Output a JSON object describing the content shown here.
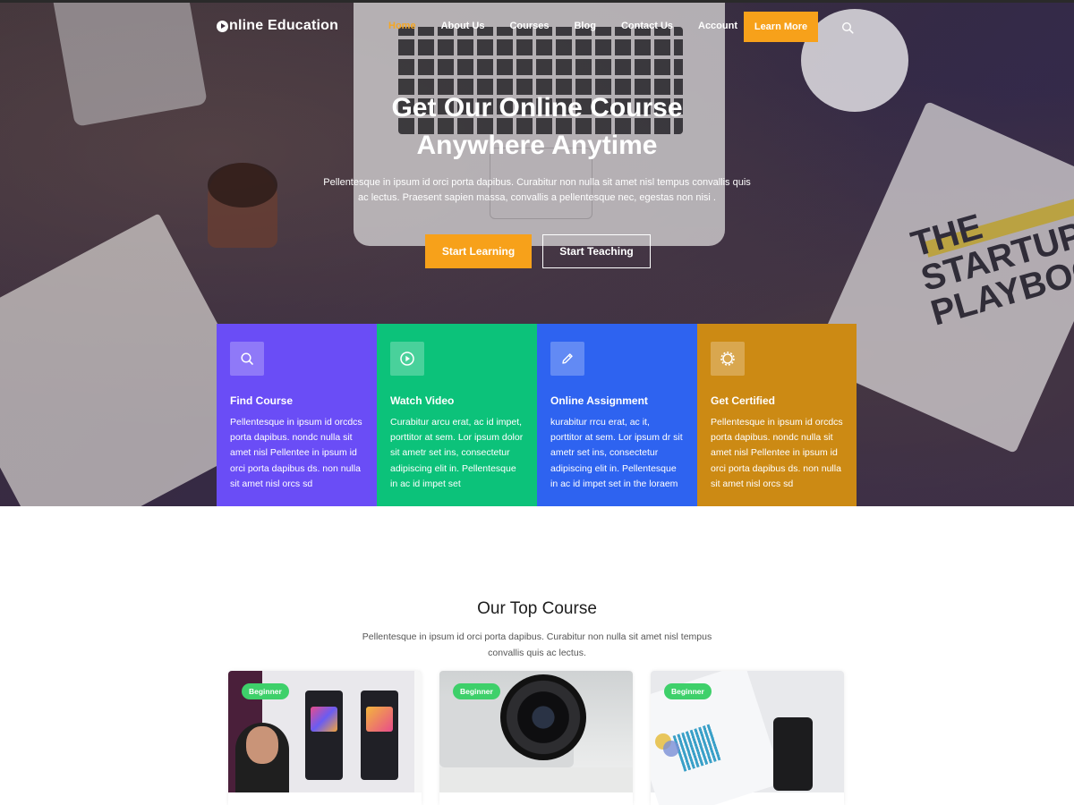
{
  "brand": {
    "logo_text": "nline Education",
    "logo_icon": "play-circle-icon"
  },
  "nav": {
    "items": [
      {
        "label": "Home",
        "active": true
      },
      {
        "label": "About Us"
      },
      {
        "label": "Courses"
      },
      {
        "label": "Blog"
      },
      {
        "label": "Contact Us"
      },
      {
        "label": "Account"
      }
    ],
    "cta_label": "Learn More",
    "search_icon": "search-icon"
  },
  "hero": {
    "title_line1": "Get Our Online Course",
    "title_line2": "Anywhere Anytime",
    "description": "Pellentesque in ipsum id orci porta dapibus. Curabitur non nulla sit amet nisl tempus convallis quis ac lectus. Praesent sapien massa, convallis a pellentesque nec, egestas non nisi .",
    "primary_button": "Start Learning",
    "secondary_button": "Start Teaching",
    "book_title": "THE STARTUP PLAYBOOK"
  },
  "features": [
    {
      "icon": "search-icon",
      "title": "Find Course",
      "text": "Pellentesque in ipsum id orcdcs porta dapibus. nondc nulla sit amet nisl Pellentee in ipsum id orci porta dapibus ds. non nulla sit amet nisl  orcs sd",
      "color": "#6a4df6"
    },
    {
      "icon": "play-circle-icon",
      "title": "Watch Video",
      "text": "Curabitur arcu erat, ac id impet, porttitor at sem. Lor ipsum dolor sit ametr set ins, consectetur adipiscing elit in. Pellentesque in ac id impet set",
      "color": "#0cc27a"
    },
    {
      "icon": "pencil-icon",
      "title": "Online Assignment",
      "text": "kurabitur rrcu erat, ac it, porttitor at sem. Lor ipsum dr sit ametr set ins, consectetur adipiscing elit in. Pellentesque in ac id impet set in the loraem",
      "color": "#2e63f0"
    },
    {
      "icon": "badge-icon",
      "title": "Get Certified",
      "text": "Pellentesque in ipsum id orcdcs porta dapibus. nondc nulla sit amet nisl Pellentee in ipsum id orci porta dapibus ds. non nulla sit amet nisl  orcs sd",
      "color": "#cc8a14"
    }
  ],
  "top_course": {
    "title": "Our Top Course",
    "description": "Pellentesque in ipsum id orci porta dapibus. Curabitur non nulla sit amet nisl tempus convallis quis ac lectus.",
    "cards": [
      {
        "badge": "Beginner",
        "image": "design-app-instructor"
      },
      {
        "badge": "Beginner",
        "image": "camera-lens"
      },
      {
        "badge": "Beginner",
        "image": "documents-and-phone"
      }
    ]
  },
  "colors": {
    "accent": "#f7a11a",
    "badge_green": "#3ed06a"
  }
}
